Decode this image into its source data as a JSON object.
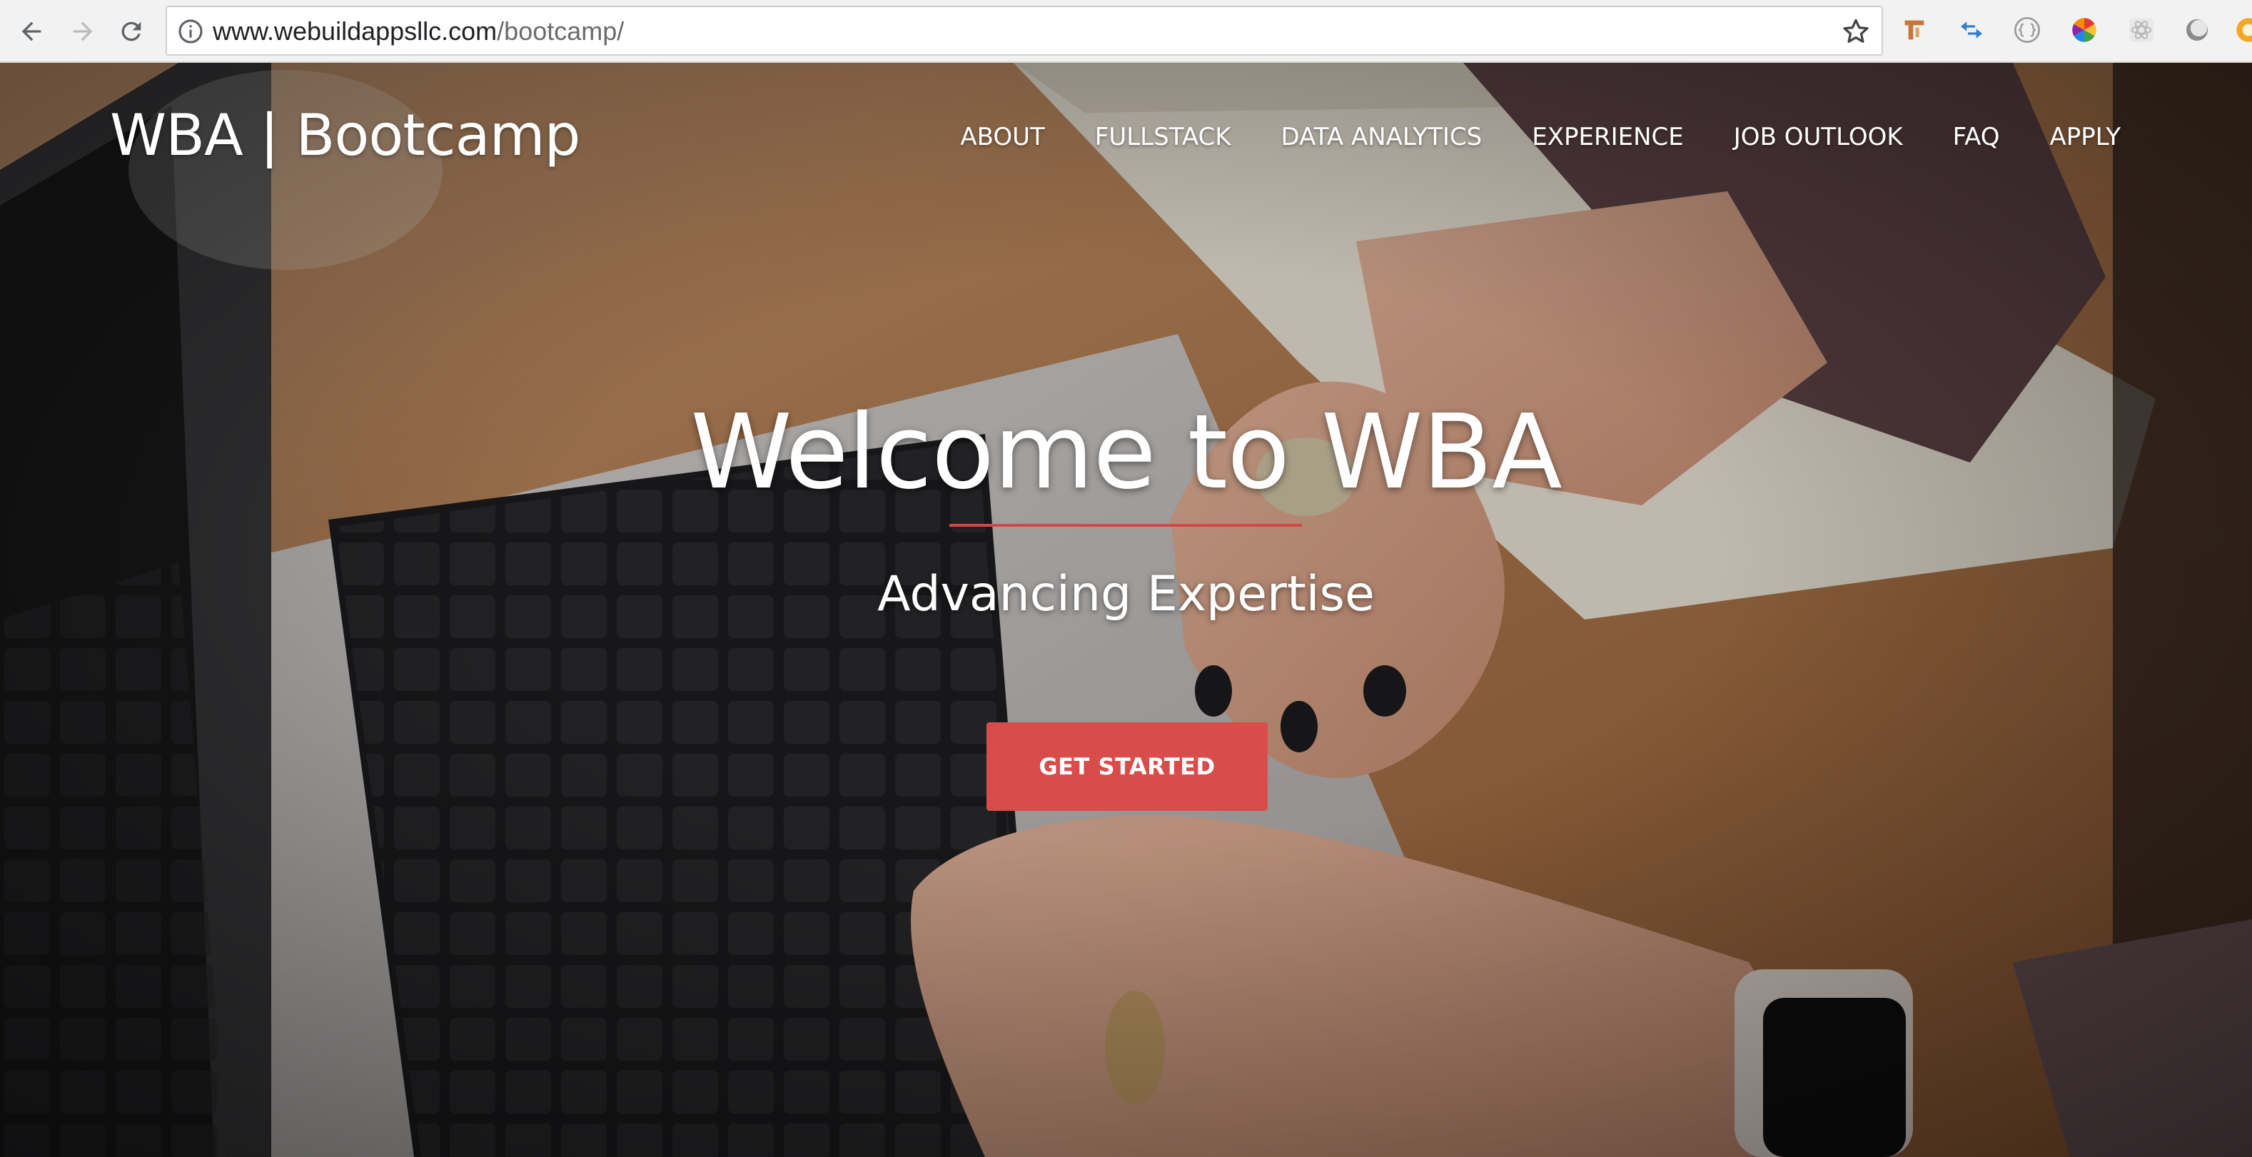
{
  "browser": {
    "url_host": "www.webuildappsllc.com",
    "url_path": "/bootcamp/",
    "icons": {
      "back": "back-arrow-icon",
      "forward": "forward-arrow-icon",
      "reload": "reload-icon",
      "site_info": "info-icon",
      "bookmark": "star-icon"
    },
    "extensions": [
      "tool-extension-icon",
      "arrows-extension-icon",
      "code-braces-extension-icon",
      "color-wheel-extension-icon",
      "react-extension-icon",
      "circle-extension-icon",
      "orange-extension-icon"
    ]
  },
  "site": {
    "brand": "WBA | Bootcamp",
    "nav": [
      {
        "label": "ABOUT"
      },
      {
        "label": "FULLSTACK"
      },
      {
        "label": "DATA ANALYTICS"
      },
      {
        "label": "EXPERIENCE"
      },
      {
        "label": "JOB OUTLOOK"
      },
      {
        "label": "FAQ"
      },
      {
        "label": "APPLY"
      }
    ]
  },
  "hero": {
    "title": "Welcome to WBA",
    "subtitle": "Advancing Expertise",
    "cta_label": "GET STARTED",
    "accent_color": "#d94c4c"
  }
}
